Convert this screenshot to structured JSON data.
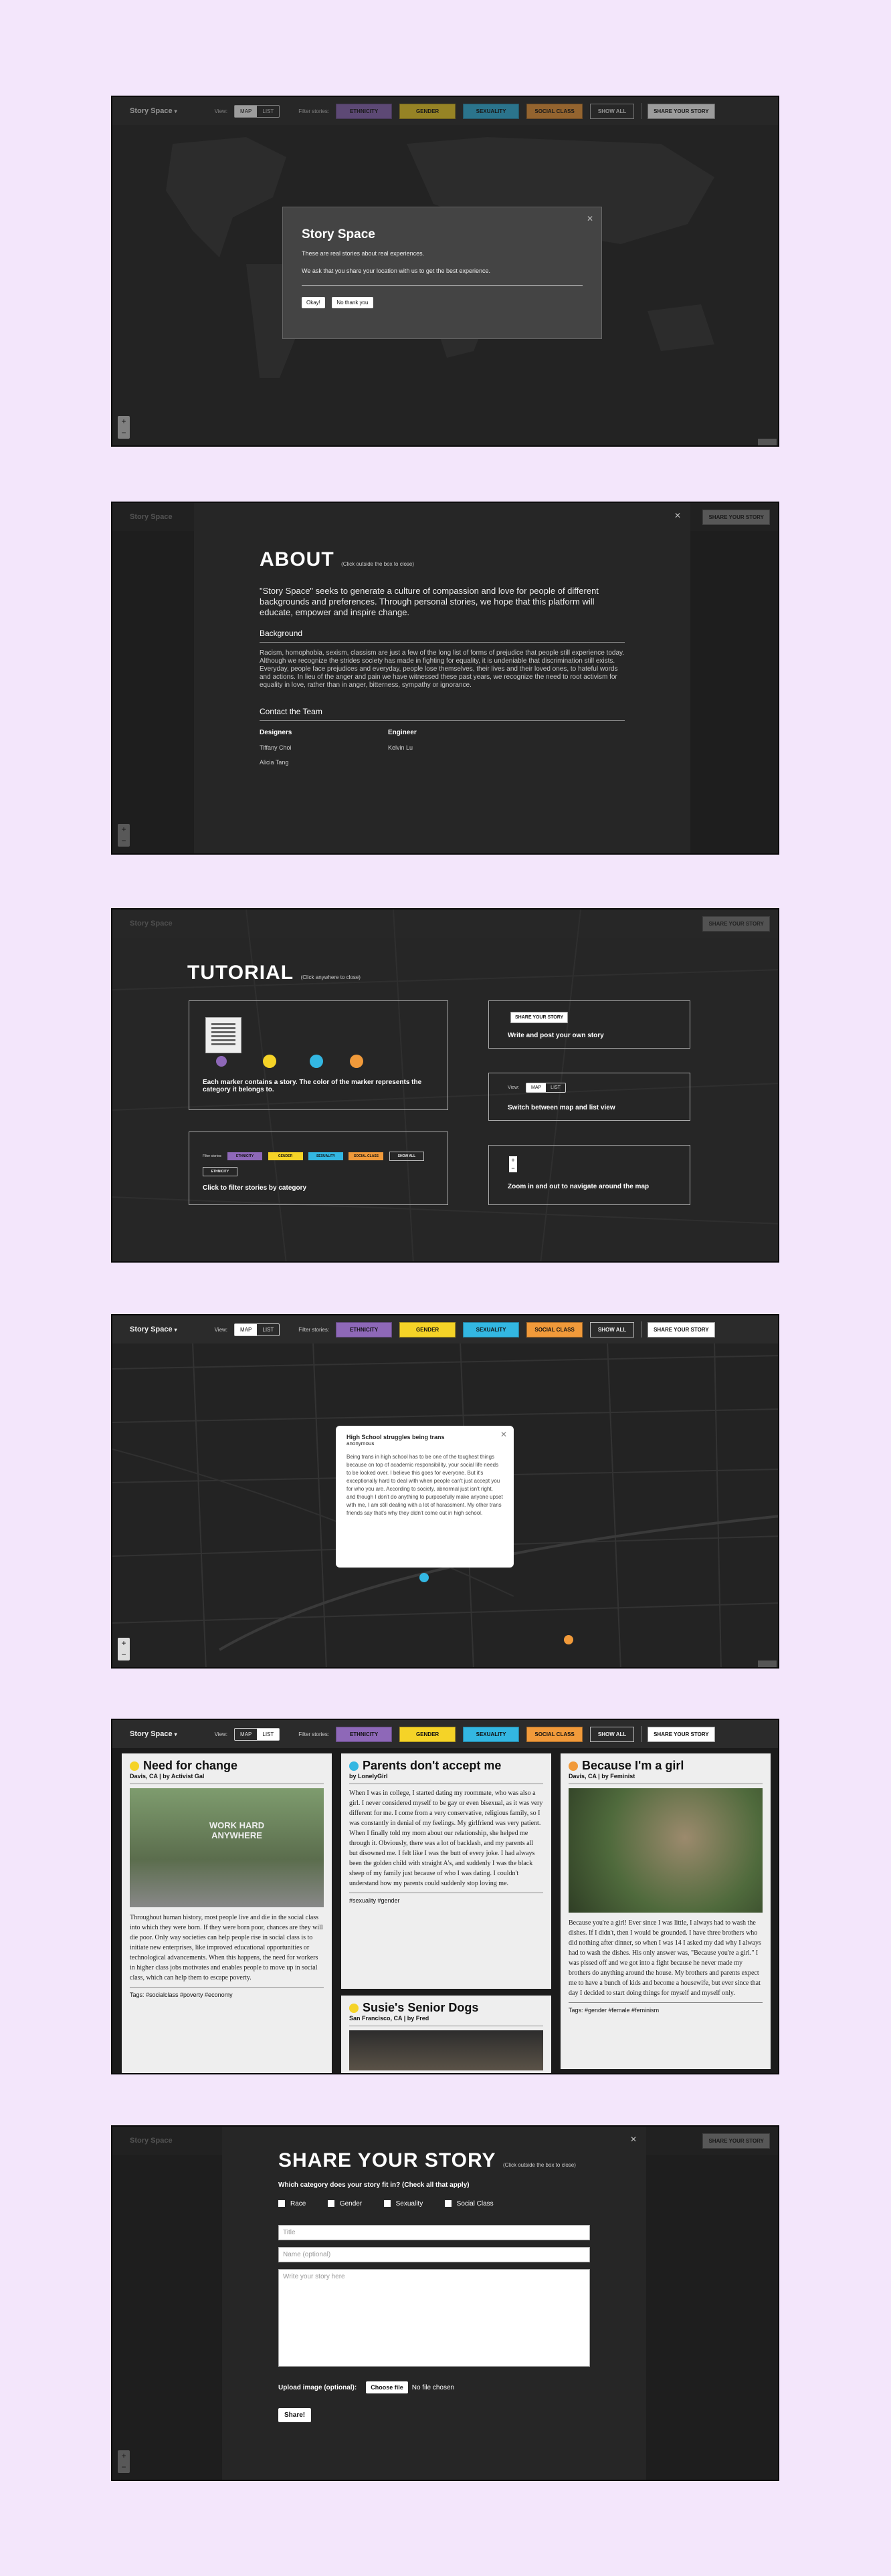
{
  "toolbar": {
    "brand": "Story Space",
    "view_label": "View:",
    "map": "MAP",
    "list": "LIST",
    "filter_label": "Filter stories:",
    "ethnicity": "ETHNICITY",
    "gender": "GENDER",
    "sexuality": "SEXUALITY",
    "social_class": "SOCIAL CLASS",
    "show_all": "SHOW ALL",
    "share": "SHARE YOUR STORY"
  },
  "colors": {
    "ethnicity": "#8e68b8",
    "gender": "#f5d327",
    "sexuality": "#33b7e2",
    "social_class": "#f19a3a"
  },
  "welcome": {
    "title": "Story Space",
    "line1": "These are real stories about real experiences.",
    "line2": "We ask that you share your location with us to get the best experience.",
    "okay": "Okay!",
    "no": "No thank you"
  },
  "about": {
    "title": "ABOUT",
    "hint": "(Click outside the box to close)",
    "lead": "\"Story Space\" seeks to generate a culture of compassion and love for people of different backgrounds and preferences. Through personal stories, we hope that this platform will educate, empower and inspire change.",
    "bg_title": "Background",
    "bg_text": "Racism, homophobia, sexism, classism are just a few of the long list of forms of prejudice that people still experience today. Although we recognize the strides society has made in fighting for equality, it is undeniable that discrimination still exists. Everyday, people face prejudices and everyday, people lose themselves, their lives and their loved ones, to hateful words and actions. In lieu of the anger and pain we have witnessed these past years, we recognize the need to root activism for equality in love, rather than in anger, bitterness, sympathy or ignorance.",
    "team_title": "Contact the Team",
    "designers_label": "Designers",
    "designer1": "Tiffany Choi",
    "designer2": "Alicia Tang",
    "engineer_label": "Engineer",
    "engineer1": "Kelvin Lu"
  },
  "tutorial": {
    "title": "TUTORIAL",
    "hint": "(Click anywhere to close)",
    "markers": "Each marker contains a story. The color of the marker represents the category it belongs to.",
    "filter": "Click to filter stories by category",
    "share": "Write and post your own story",
    "switch": "Switch between map and list view",
    "zoom": "Zoom in and out to navigate around the map"
  },
  "popup": {
    "title": "High School struggles being trans",
    "author": "anonymous",
    "body": "Being trans in high school has to be one of the toughest things because on top of academic responsibility, your social life needs to be looked over. I believe this goes for everyone. But it's exceptionally hard to deal with when people can't just accept you for who you are. According to society, abnormal just isn't right, and though I don't do anything to purposefully make anyone upset with me, I am still dealing with a lot of harassment. My other trans friends say that's why they didn't come out in high school."
  },
  "stories": {
    "s1": {
      "title": "Need for change",
      "by": "Davis, CA | by Activist Gal",
      "text": "Throughout human history, most people live and die in the social class into which they were born. If they were born poor, chances are they will die poor. Only way societies can help people rise in social class is to initiate new enterprises, like improved educational opportunities or technological advancements. When this happens, the need for workers in higher class jobs motivates and enables people to move up in social class, which can help them to escape poverty.",
      "tags": "Tags: #socialclass #poverty #economy",
      "img_text": "WORK HARD ANYWHERE"
    },
    "s2": {
      "title": "Parents don't accept me",
      "by": "by LonelyGirl",
      "text": "When I was in college, I started dating my roommate, who was also a girl. I never considered myself to be gay or even bisexual, as it was very different for me. I come from a very conservative, religious family, so I was constantly in denial of my feelings. My girlfriend was very patient. When I finally told my mom about our relationship, she helped me through it. Obviously, there was a lot of backlash, and my parents all but disowned me. I felt like I was the butt of every joke. I had always been the golden child with straight A's, and suddenly I was the black sheep of my family just because of who I was dating. I couldn't understand how my parents could suddenly stop loving me.",
      "tags": "#sexuality #gender"
    },
    "s3": {
      "title": "Susie's Senior Dogs",
      "by": "San Francisco, CA | by Fred"
    },
    "s4": {
      "title": "Because I'm a girl",
      "by": "Davis, CA | by Feminist",
      "text": "Because you're a girl! Ever since I was little, I always had to wash the dishes. If I didn't, then I would be grounded. I have three brothers who did nothing after dinner, so when I was 14 I asked my dad why I always had to wash the dishes. His only answer was, \"Because you're a girl.\" I was pissed off and we got into a fight because he never made my brothers do anything around the house. My brothers and parents expect me to have a bunch of kids and become a housewife, but ever since that day I decided to start doing things for myself and myself only.",
      "tags": "Tags: #gender #female #feminism"
    }
  },
  "share": {
    "title": "SHARE YOUR STORY",
    "hint": "(Click outside the box to close)",
    "question": "Which category does your story fit in? (Check all that apply)",
    "opt1": "Race",
    "opt2": "Gender",
    "opt3": "Sexuality",
    "opt4": "Social Class",
    "title_ph": "Title",
    "name_ph": "Name (optional)",
    "story_ph": "Write your story here",
    "upload_label": "Upload image (optional):",
    "choose": "Choose file",
    "no_file": "No file chosen",
    "submit": "Share!"
  }
}
